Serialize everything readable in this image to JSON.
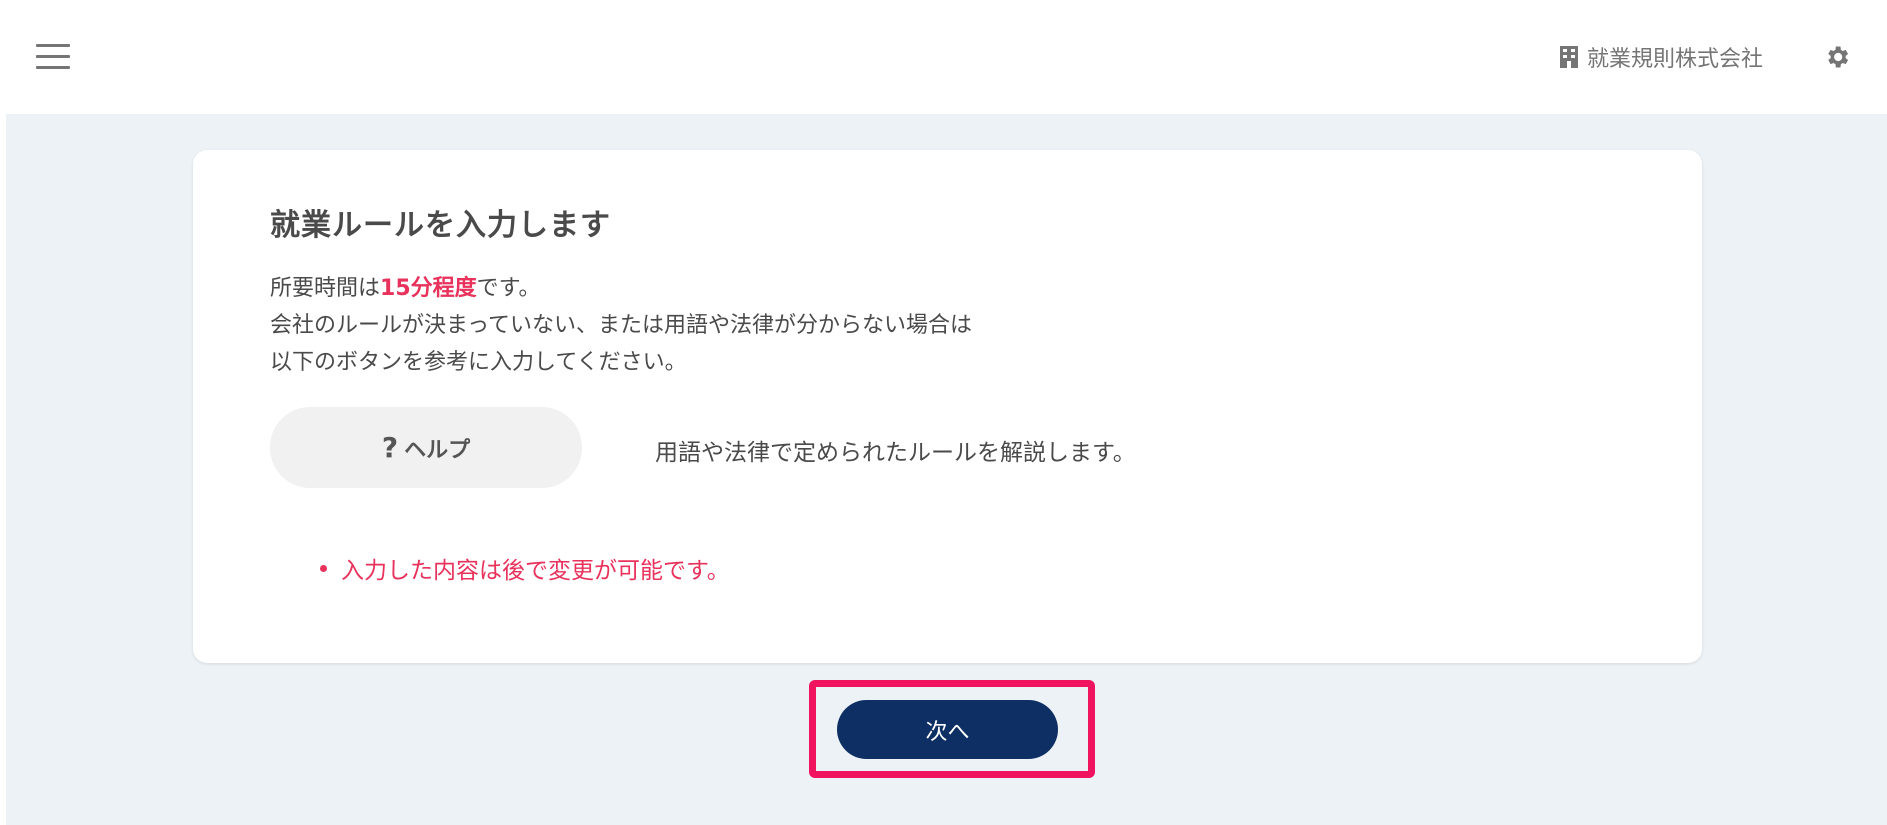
{
  "header": {
    "company_name": "就業規則株式会社",
    "menu_icon": "hamburger-menu-icon",
    "company_icon": "building-icon",
    "settings_icon": "gear-icon"
  },
  "card": {
    "title": "就業ルールを入力します",
    "desc_line1_prefix": "所要時間は",
    "desc_line1_highlight": "15分程度",
    "desc_line1_suffix": "です。",
    "desc_line2": "会社のルールが決まっていない、または用語や法律が分からない場合は",
    "desc_line3": "以下のボタンを参考に入力してください。",
    "help_button_icon": "?",
    "help_button_label": "ヘルプ",
    "help_description": "用語や法律で定められたルールを解説します。",
    "notice": "入力した内容は後で変更が可能です。"
  },
  "footer": {
    "next_label": "次へ"
  },
  "colors": {
    "accent_red": "#e8325c",
    "primary_navy": "#0d2f63",
    "highlight_pink": "#f0145e",
    "background": "#ecf2f6"
  }
}
